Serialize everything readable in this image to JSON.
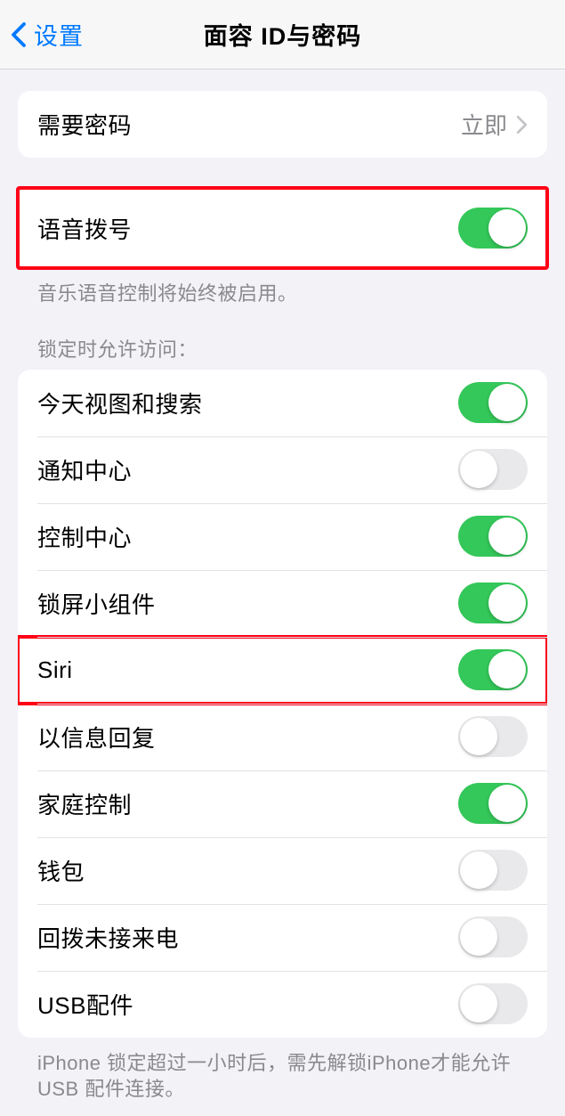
{
  "header": {
    "back_label": "设置",
    "title": "面容 ID与密码"
  },
  "require_passcode": {
    "label": "需要密码",
    "value": "立即"
  },
  "voice_dial": {
    "label": "语音拨号",
    "enabled": true,
    "footer": "音乐语音控制将始终被启用。"
  },
  "lock_section": {
    "header": "锁定时允许访问：",
    "items": [
      {
        "label": "今天视图和搜索",
        "enabled": true
      },
      {
        "label": "通知中心",
        "enabled": false
      },
      {
        "label": "控制中心",
        "enabled": true
      },
      {
        "label": "锁屏小组件",
        "enabled": true
      },
      {
        "label": "Siri",
        "enabled": true
      },
      {
        "label": "以信息回复",
        "enabled": false
      },
      {
        "label": "家庭控制",
        "enabled": true
      },
      {
        "label": "钱包",
        "enabled": false
      },
      {
        "label": "回拨未接来电",
        "enabled": false
      },
      {
        "label": "USB配件",
        "enabled": false
      }
    ],
    "footer": "iPhone 锁定超过一小时后，需先解锁iPhone才能允许USB 配件连接。"
  }
}
